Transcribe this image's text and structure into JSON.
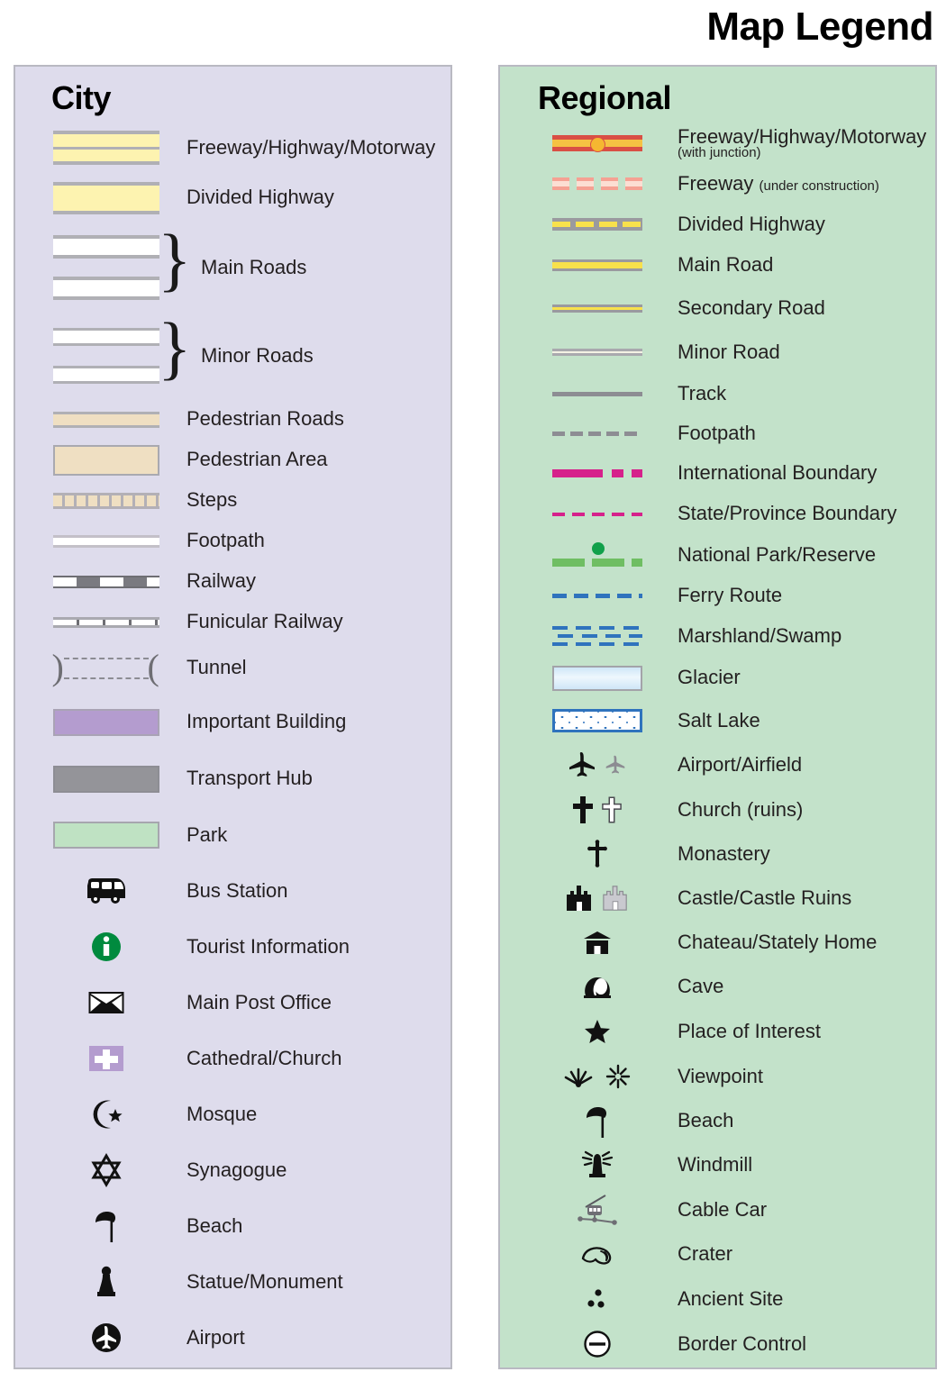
{
  "title": "Map Legend",
  "panels": {
    "city": {
      "heading": "City",
      "background_color": "#dedcec",
      "items": [
        {
          "label": "Freeway/Highway/Motorway",
          "symbol": "freeway-swatch"
        },
        {
          "label": "Divided Highway",
          "symbol": "divided-highway-swatch"
        },
        {
          "label": "Main Roads",
          "symbol": "main-roads-swatch-pair"
        },
        {
          "label": "Minor Roads",
          "symbol": "minor-roads-swatch-pair"
        },
        {
          "label": "Pedestrian Roads",
          "symbol": "pedestrian-road-swatch"
        },
        {
          "label": "Pedestrian Area",
          "symbol": "pedestrian-area-swatch"
        },
        {
          "label": "Steps",
          "symbol": "steps-swatch"
        },
        {
          "label": "Footpath",
          "symbol": "footpath-swatch"
        },
        {
          "label": "Railway",
          "symbol": "railway-swatch"
        },
        {
          "label": "Funicular Railway",
          "symbol": "funicular-railway-swatch"
        },
        {
          "label": "Tunnel",
          "symbol": "tunnel-swatch"
        },
        {
          "label": "Important Building",
          "symbol": "important-building-swatch"
        },
        {
          "label": "Transport Hub",
          "symbol": "transport-hub-swatch"
        },
        {
          "label": "Park",
          "symbol": "park-swatch"
        },
        {
          "label": "Bus Station",
          "symbol": "bus-icon"
        },
        {
          "label": "Tourist Information",
          "symbol": "info-icon"
        },
        {
          "label": "Main Post Office",
          "symbol": "envelope-icon"
        },
        {
          "label": "Cathedral/Church",
          "symbol": "cross-square-icon"
        },
        {
          "label": "Mosque",
          "symbol": "crescent-star-icon"
        },
        {
          "label": "Synagogue",
          "symbol": "star-of-david-icon"
        },
        {
          "label": "Beach",
          "symbol": "parasol-icon"
        },
        {
          "label": "Statue/Monument",
          "symbol": "statue-icon"
        },
        {
          "label": "Airport",
          "symbol": "airport-circle-icon"
        }
      ]
    },
    "regional": {
      "heading": "Regional",
      "background_color": "#c3e2ca",
      "items": [
        {
          "label": "Freeway/Highway/Motorway",
          "sub": "(with junction)",
          "sub_block": true,
          "symbol": "regional-freeway-junction-swatch"
        },
        {
          "label": "Freeway",
          "sub": "(under construction)",
          "sub_block": false,
          "symbol": "freeway-under-construction-swatch"
        },
        {
          "label": "Divided Highway",
          "symbol": "regional-divided-highway-swatch"
        },
        {
          "label": "Main Road",
          "symbol": "regional-main-road-swatch"
        },
        {
          "label": "Secondary Road",
          "symbol": "secondary-road-swatch"
        },
        {
          "label": "Minor Road",
          "symbol": "regional-minor-road-swatch"
        },
        {
          "label": "Track",
          "symbol": "track-swatch"
        },
        {
          "label": "Footpath",
          "symbol": "regional-footpath-swatch"
        },
        {
          "label": "International Boundary",
          "symbol": "international-boundary-swatch"
        },
        {
          "label": "State/Province Boundary",
          "symbol": "state-boundary-swatch"
        },
        {
          "label": "National Park/Reserve",
          "symbol": "national-park-swatch"
        },
        {
          "label": "Ferry Route",
          "symbol": "ferry-route-swatch"
        },
        {
          "label": "Marshland/Swamp",
          "symbol": "marshland-swatch"
        },
        {
          "label": "Glacier",
          "symbol": "glacier-swatch"
        },
        {
          "label": "Salt Lake",
          "symbol": "salt-lake-swatch"
        },
        {
          "label": "Airport/Airfield",
          "symbol": "airplane-pair-icon"
        },
        {
          "label": "Church (ruins)",
          "symbol": "church-cross-pair-icon"
        },
        {
          "label": "Monastery",
          "symbol": "monastery-cross-icon"
        },
        {
          "label": "Castle/Castle Ruins",
          "symbol": "castle-pair-icon"
        },
        {
          "label": "Chateau/Stately Home",
          "symbol": "chateau-icon"
        },
        {
          "label": "Cave",
          "symbol": "cave-icon"
        },
        {
          "label": "Place of Interest",
          "symbol": "star-icon"
        },
        {
          "label": "Viewpoint",
          "symbol": "viewpoint-pair-icon"
        },
        {
          "label": "Beach",
          "symbol": "parasol-icon"
        },
        {
          "label": "Windmill",
          "symbol": "windmill-icon"
        },
        {
          "label": "Cable Car",
          "symbol": "cable-car-icon"
        },
        {
          "label": "Crater",
          "symbol": "crater-icon"
        },
        {
          "label": "Ancient Site",
          "symbol": "ancient-site-icon"
        },
        {
          "label": "Border Control",
          "symbol": "border-control-icon"
        }
      ]
    }
  },
  "colors": {
    "city_panel": "#dedcec",
    "regional_panel": "#c3e2ca",
    "road_yellow": "#fdf3b0",
    "regional_road_yellow": "#f8e14c",
    "freeway_red": "#d94f45",
    "freeway_orange": "#f5c243",
    "boundary_magenta": "#d6218b",
    "water_blue": "#2f73bd",
    "park_green": "#6fbe63",
    "important_building_purple": "#b49ccf",
    "transport_hub_gray": "#949499",
    "park_swatch_green": "#bfe2c3",
    "pedestrian_tan": "#efdfc2",
    "text": "#231f20"
  }
}
